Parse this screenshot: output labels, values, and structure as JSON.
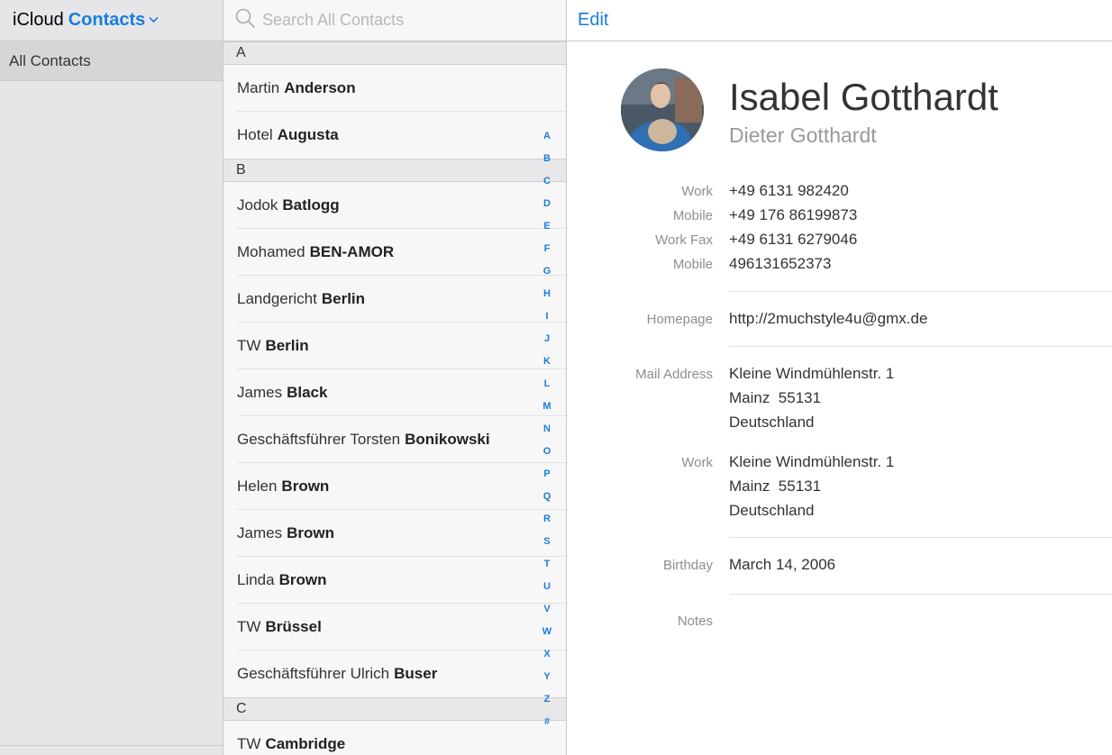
{
  "sidebar": {
    "app_prefix": "iCloud",
    "app_name": "Contacts",
    "groups": [
      {
        "label": "All Contacts"
      }
    ]
  },
  "search": {
    "placeholder": "Search All Contacts"
  },
  "sections": [
    {
      "letter": "A",
      "rows": [
        {
          "first": "Martin",
          "last": "Anderson"
        },
        {
          "first": "Hotel",
          "last": "Augusta"
        }
      ]
    },
    {
      "letter": "B",
      "rows": [
        {
          "first": "Jodok",
          "last": "Batlogg"
        },
        {
          "first": "Mohamed",
          "last": "BEN-AMOR"
        },
        {
          "first": "Landgericht",
          "last": "Berlin"
        },
        {
          "first": "TW",
          "last": "Berlin"
        },
        {
          "first": "James",
          "last": "Black"
        },
        {
          "first": "Geschäftsführer Torsten",
          "last": "Bonikowski"
        },
        {
          "first": "Helen",
          "last": "Brown"
        },
        {
          "first": "James",
          "last": "Brown"
        },
        {
          "first": "Linda",
          "last": "Brown"
        },
        {
          "first": "TW",
          "last": "Brüssel"
        },
        {
          "first": "Geschäftsführer Ulrich",
          "last": "Buser"
        }
      ]
    },
    {
      "letter": "C",
      "rows": [
        {
          "first": "TW",
          "last": "Cambridge"
        }
      ]
    }
  ],
  "alpha_index": [
    "A",
    "B",
    "C",
    "D",
    "E",
    "F",
    "G",
    "H",
    "I",
    "J",
    "K",
    "L",
    "M",
    "N",
    "O",
    "P",
    "Q",
    "R",
    "S",
    "T",
    "U",
    "V",
    "W",
    "X",
    "Y",
    "Z",
    "#"
  ],
  "detail": {
    "edit_label": "Edit",
    "name": "Isabel Gotthardt",
    "company": "Dieter Gotthardt",
    "phones": [
      {
        "label": "Work",
        "value": "+49 6131 982420"
      },
      {
        "label": "Mobile",
        "value": "+49 176 86199873"
      },
      {
        "label": "Work Fax",
        "value": "+49 6131 6279046"
      },
      {
        "label": "Mobile",
        "value": "496131652373"
      }
    ],
    "homepage": {
      "label": "Homepage",
      "value": "http://2muchstyle4u@gmx.de"
    },
    "addresses": [
      {
        "label": "Mail Address",
        "street": "Kleine Windmühlenstr. 1",
        "city_line": "Mainz  55131",
        "country": "Deutschland"
      },
      {
        "label": "Work",
        "street": "Kleine Windmühlenstr. 1",
        "city_line": "Mainz  55131",
        "country": "Deutschland"
      }
    ],
    "birthday": {
      "label": "Birthday",
      "value": "March 14, 2006"
    },
    "notes": {
      "label": "Notes",
      "value": ""
    }
  }
}
